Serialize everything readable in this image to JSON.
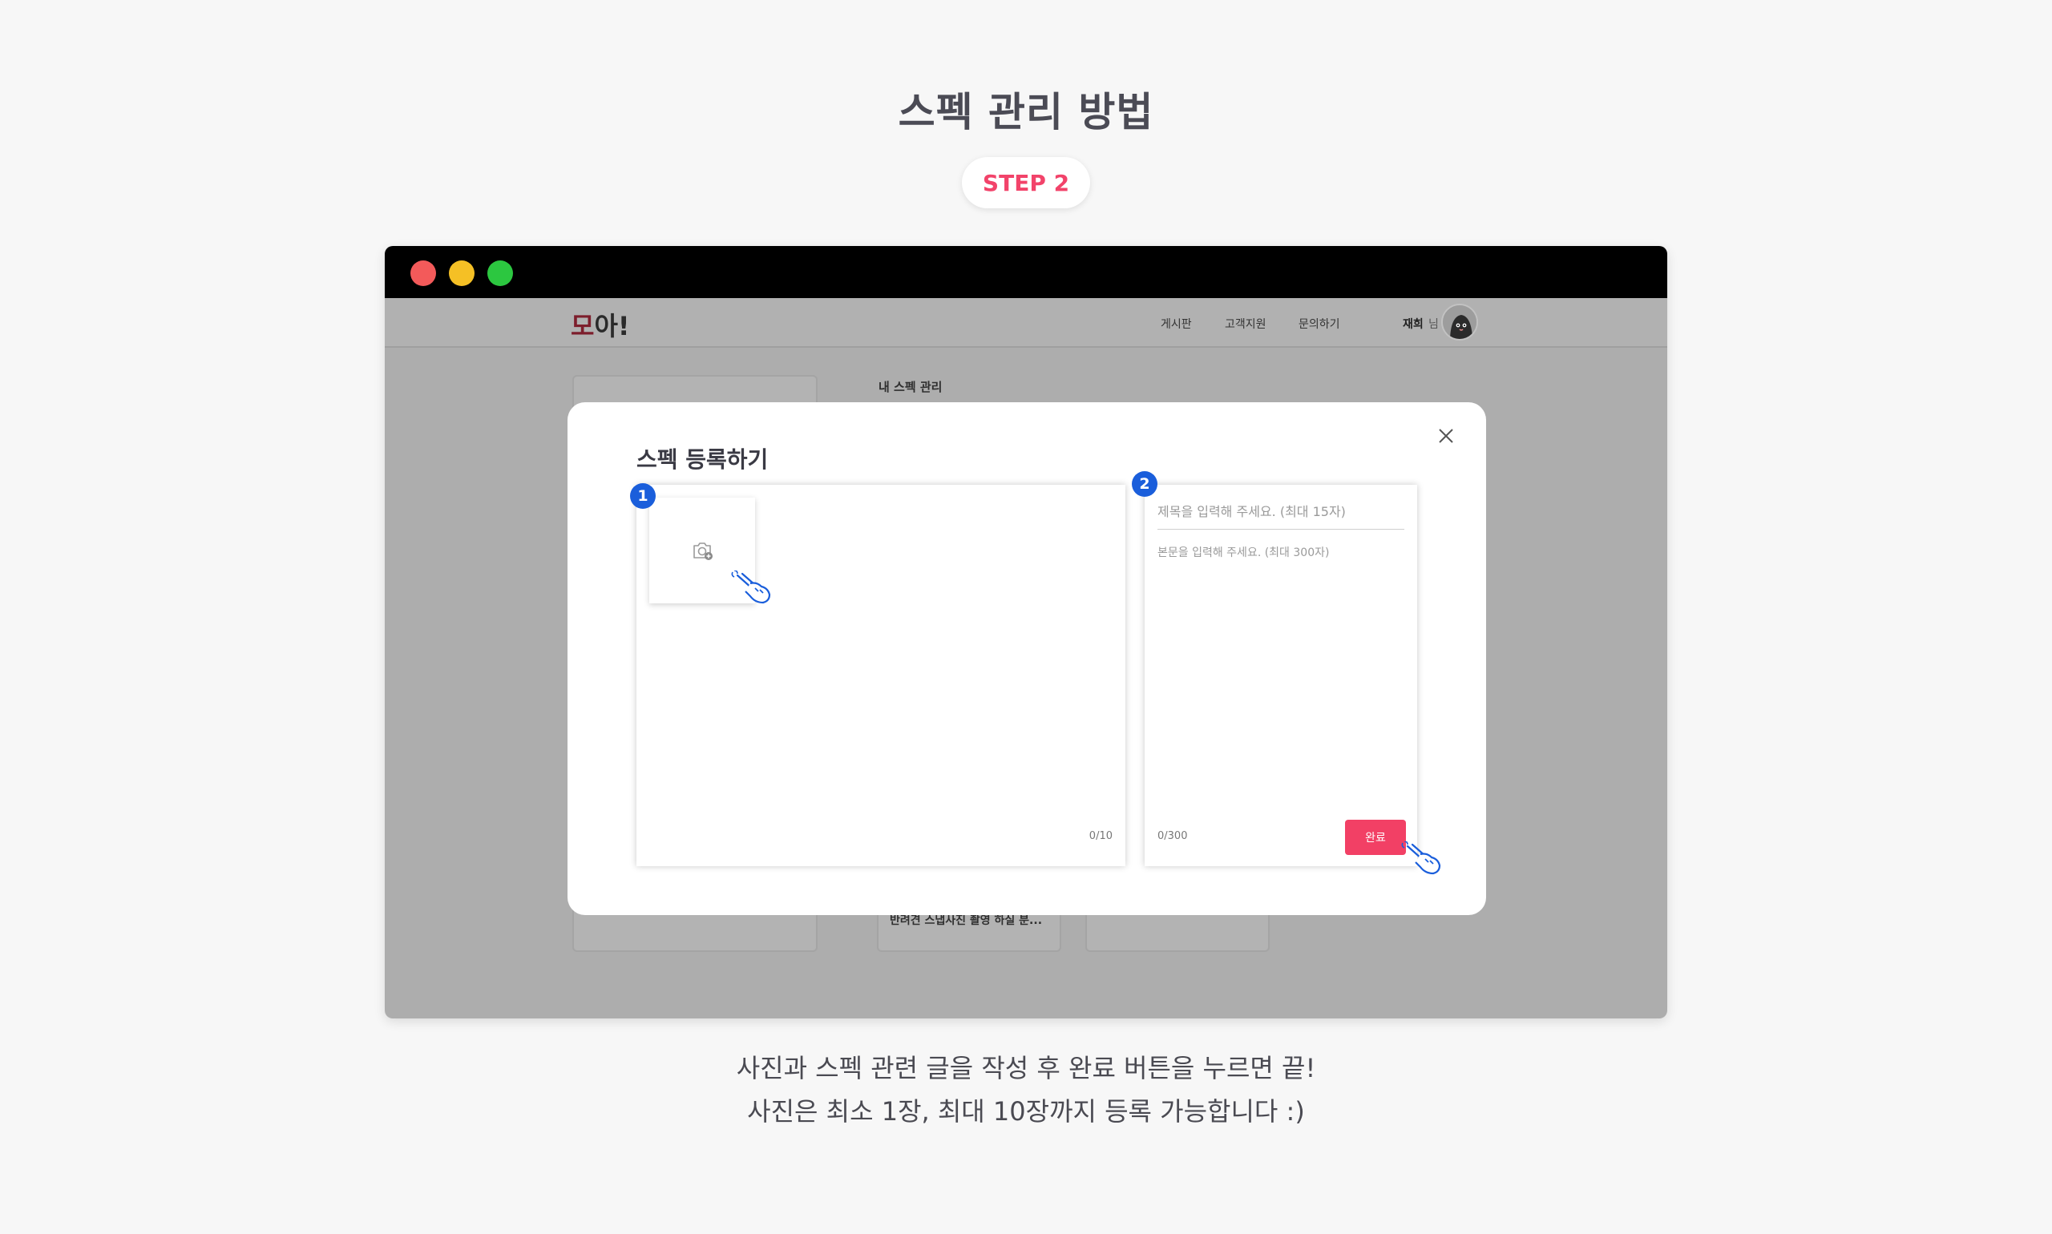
{
  "page": {
    "title": "스펙 관리 방법",
    "step_label": "STEP 2",
    "caption_line1": "사진과 스펙 관련 글을 작성 후 완료 버튼을 누르면 끝!",
    "caption_line2": "사진은 최소 1장, 최대 10장까지 등록 가능합니다 :)"
  },
  "header": {
    "logo_prefix": "모",
    "logo_suffix": "아!",
    "nav": [
      "게시판",
      "고객지원",
      "문의하기"
    ],
    "user_name": "재희",
    "user_suffix": "님"
  },
  "background": {
    "section_title": "내 스펙 관리",
    "card_caption": "반려견 스냅사진 촬영 하실 분..."
  },
  "modal": {
    "title": "스펙 등록하기",
    "photo_badge": "1",
    "photo_counter": "0/10",
    "text_badge": "2",
    "title_placeholder": "제목을 입력해 주세요. (최대 15자)",
    "body_placeholder": "본문을 입력해 주세요. (최대 300자)",
    "text_counter": "0/300",
    "done_label": "완료"
  },
  "colors": {
    "accent": "#f24065",
    "badge_blue": "#1a5edb",
    "window_red": "#f35a5a",
    "window_yellow": "#f5c025",
    "window_green": "#2cc740"
  },
  "icons": {
    "upload": "camera-plus-icon",
    "pointer": "hand-pointer-icon",
    "close": "close-icon"
  }
}
